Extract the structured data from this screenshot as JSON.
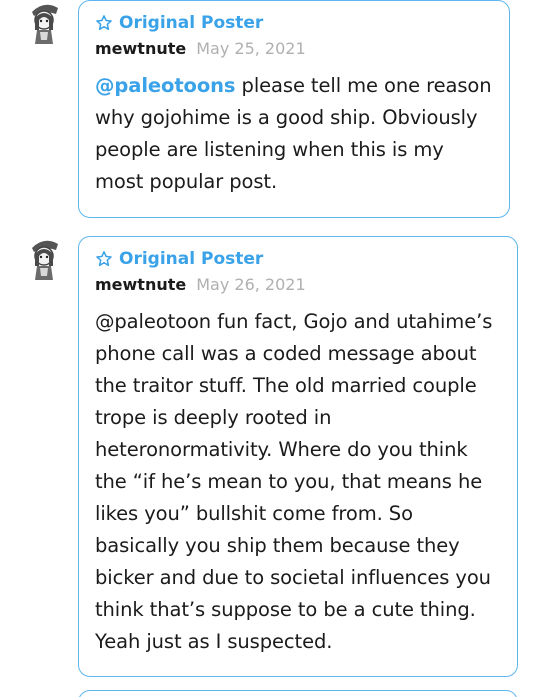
{
  "replies": [
    {
      "badge": "Original Poster",
      "username": "mewtnute",
      "date": "May 25, 2021",
      "mention": "@paleotoons",
      "text": " please tell me one reason why gojohime is a good ship. Obviously people are listening when this is my most popular post."
    },
    {
      "badge": "Original Poster",
      "username": "mewtnute",
      "date": "May 26, 2021",
      "text": "@paleotoon fun fact, Gojo and utahime’s phone call was a coded message about the traitor stuff. The old married couple trope is deeply rooted in heteronormativity. Where do you think the “if he’s mean to you, that means he likes you” bullshit come from. So basically you ship them because they bicker and due to societal influences you think that’s suppose to be a cute thing. Yeah just as I suspected."
    }
  ],
  "icons": {
    "badge_icon": "star-outline-icon",
    "avatar": "girl-with-hat-avatar"
  },
  "colors": {
    "accent": "#3aa2e8",
    "border": "#5eb6ef",
    "text": "#1b1b1b",
    "muted": "#b0b0b0"
  }
}
